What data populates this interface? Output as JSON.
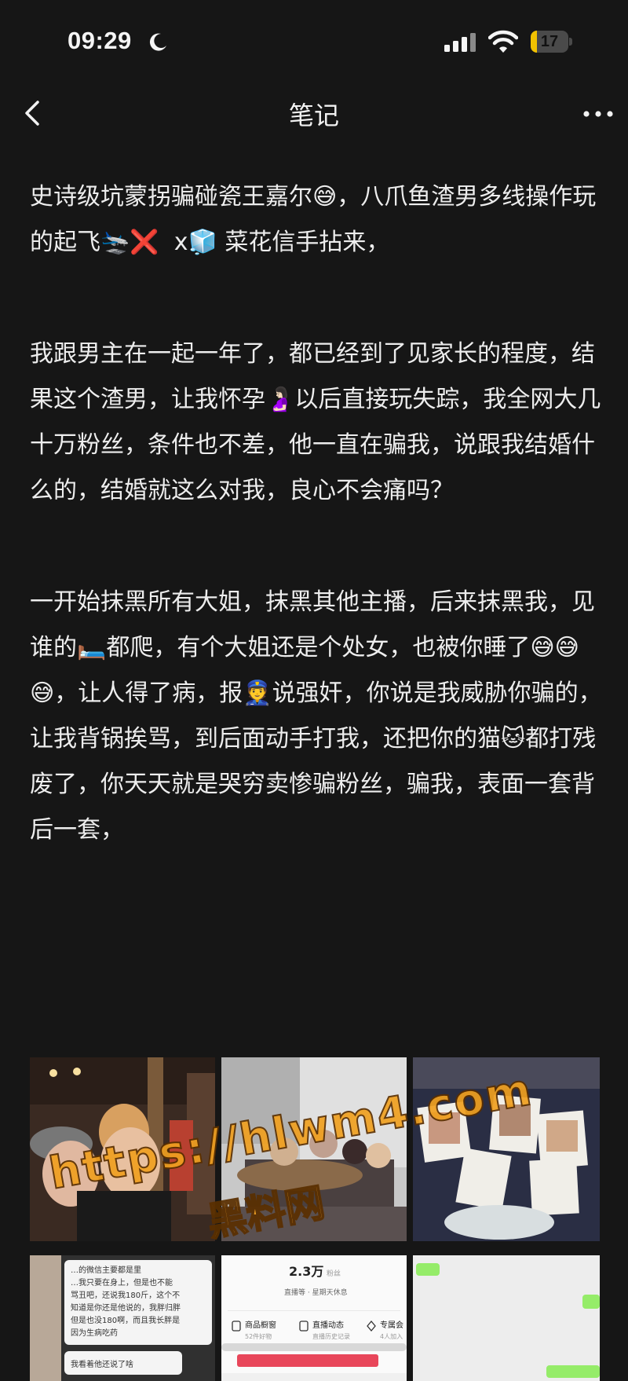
{
  "status_bar": {
    "time": "09:29",
    "battery_level": "17",
    "battery_fraction": 0.17,
    "icons": [
      "moon-icon",
      "signal-icon",
      "wifi-icon",
      "battery-icon"
    ]
  },
  "nav": {
    "title": "笔记",
    "back_icon": "chevron-left-icon",
    "more_icon": "more-icon"
  },
  "note": {
    "paragraphs": [
      "史诗级坑蒙拐骗碰瓷王嘉尔😅，八爪鱼渣男多线操作玩的起飞🛬❌  x🧊 菜花信手拈来，",
      "我跟男主在一起一年了，都已经到了见家长的程度，结果这个渣男，让我怀孕🤰🏻以后直接玩失踪，我全网大几十万粉丝，条件也不差，他一直在骗我，说跟我结婚什么的，结婚就这么对我，良心不会痛吗？",
      "一开始抹黑所有大姐，抹黑其他主播，后来抹黑我，见谁的🛏️都爬，有个大姐还是个处女，也被你睡了😅😅😅，让人得了病，报👮说强奸，你说是我威胁你骗的，让我背锅挨骂，到后面动手打我，还把你的猫🐱都打残废了，你天天就是哭穷卖惨骗粉丝，骗我，表面一套背后一套，"
    ]
  },
  "images": {
    "thumb4_text": [
      "…的微信主要都是里",
      "…我只要在身上，但是也不能",
      "骂丑吧，还说我180斤，这个不",
      "知道是你还是他说的，我胖归胖",
      "但是也没180啊，而且我长胖是",
      "因为生病吃药",
      "我看着他还说了啥"
    ],
    "thumb5_stat": "2.3万",
    "thumb5_sub": "粉丝",
    "thumb5_line": "直播等 · 星期天休息",
    "thumb5_items": [
      "商品橱窗",
      "直播动态",
      "专属会"
    ],
    "thumb5_item_subs": [
      "52件好物",
      "直播历史记录",
      "4人加入"
    ]
  },
  "watermark": {
    "url": "https://hlwm4.com",
    "label": "黑料网"
  }
}
